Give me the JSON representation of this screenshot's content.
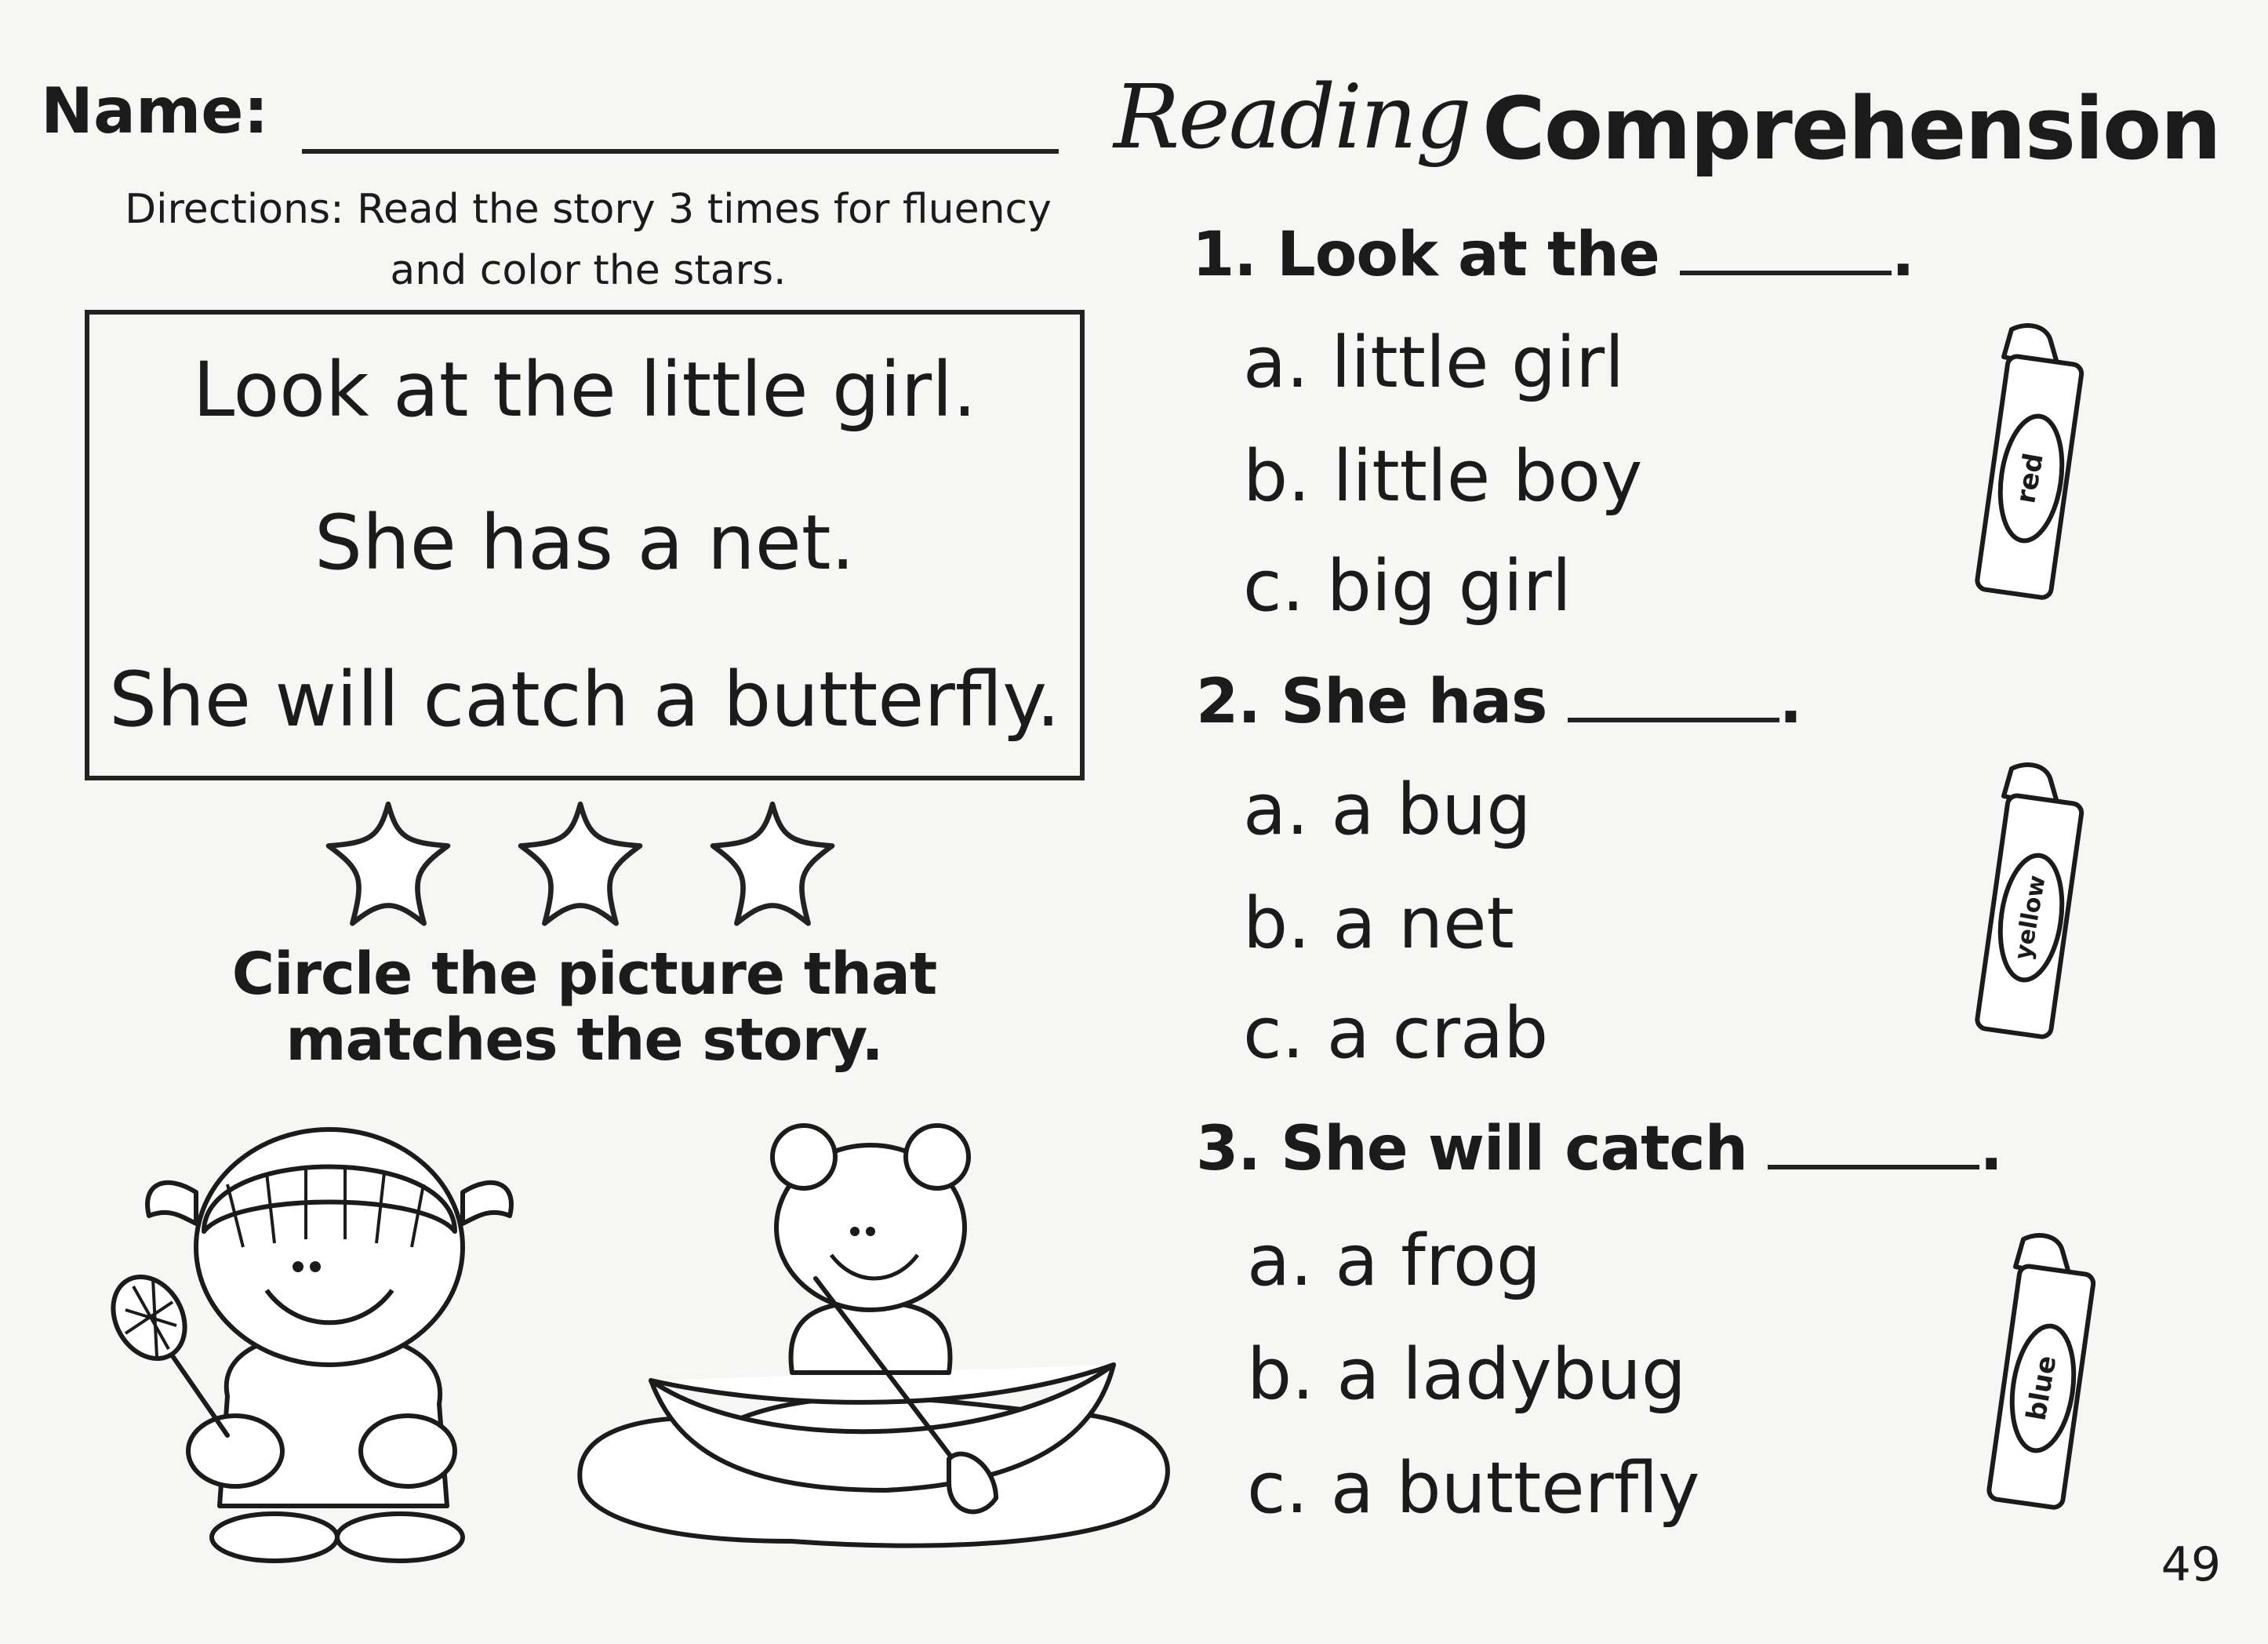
{
  "header": {
    "name_label": "Name:",
    "title_script": "Reading",
    "title_bold": "Comprehension"
  },
  "directions": "Directions: Read the story 3 times for fluency and color the stars.",
  "story": [
    "Look at the little girl.",
    "She has a net.",
    "She will catch a butterfly."
  ],
  "circle_instruction": {
    "line1": "Circle the picture that",
    "line2": "matches the story."
  },
  "questions": [
    {
      "number": "1.",
      "stem": "Look at the",
      "end": ".",
      "options": [
        "a. little girl",
        "b. little boy",
        "c. big girl"
      ],
      "crayon": "red"
    },
    {
      "number": "2.",
      "stem": "She has",
      "end": ".",
      "options": [
        "a. a bug",
        "b. a net",
        "c. a crab"
      ],
      "crayon": "yellow"
    },
    {
      "number": "3.",
      "stem": "She will catch",
      "end": ".",
      "options": [
        "a. a frog",
        "b. a ladybug",
        "c. a butterfly"
      ],
      "crayon": "blue"
    }
  ],
  "page_number": "49",
  "icons": {
    "stars": [
      "star-icon",
      "star-icon",
      "star-icon"
    ],
    "pictures": [
      "girl-with-net-icon",
      "girl-in-canoe-icon"
    ],
    "crayons": [
      "crayon-icon",
      "crayon-icon",
      "crayon-icon"
    ]
  }
}
